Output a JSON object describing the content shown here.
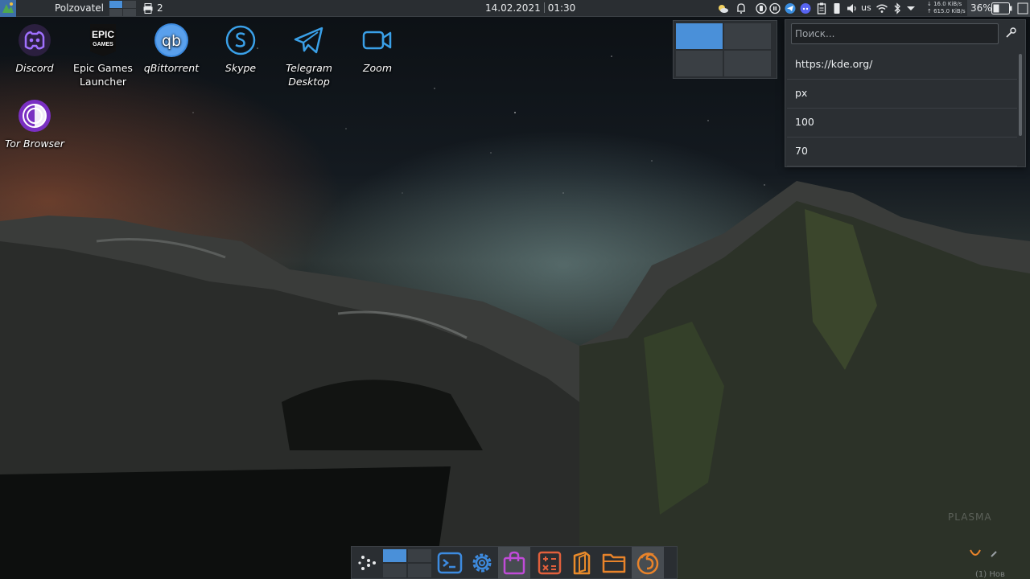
{
  "top_panel": {
    "user": "Polzovatel",
    "task_count": "2",
    "date": "14.02.2021",
    "time": "01:30",
    "keyboard_layout": "us",
    "net_down": "↓ 16.0 KiB/s",
    "net_up": "↑ 615.0 KiB/s",
    "battery": "36%"
  },
  "desktop": {
    "icons": [
      {
        "label": "Discord",
        "icon": "discord-icon",
        "color": "#8b5cf6"
      },
      {
        "label": "Epic Games Launcher",
        "icon": "epic-games-icon",
        "color": "#111111"
      },
      {
        "label": "qBittorrent",
        "icon": "qbittorrent-icon",
        "color": "#3d8be0"
      },
      {
        "label": "Skype",
        "icon": "skype-icon",
        "color": "#3aa0e8"
      },
      {
        "label": "Telegram Desktop",
        "icon": "telegram-icon",
        "color": "#3aa0e8"
      },
      {
        "label": "Zoom",
        "icon": "zoom-icon",
        "color": "#3aa0e8"
      },
      {
        "label": "Tor Browser",
        "icon": "tor-browser-icon",
        "color": "#7a2fc2"
      }
    ],
    "epic_logo_text": [
      "EPIC",
      "GAMES"
    ],
    "qb_logo_text": "qb",
    "watermark": "PLASMA",
    "corner_hint": "(1) Нов"
  },
  "clipboard": {
    "search_placeholder": "Поиск...",
    "items": [
      "https://kde.org/",
      "px",
      "100",
      "70"
    ]
  },
  "dock": {
    "items": [
      {
        "name": "app-launcher",
        "icon": "launcher-icon"
      },
      {
        "name": "pager",
        "icon": "pager-icon"
      },
      {
        "name": "terminal",
        "icon": "terminal-icon",
        "color": "#3d8be0"
      },
      {
        "name": "settings",
        "icon": "gear-icon",
        "color": "#3d8be0"
      },
      {
        "name": "software-store",
        "icon": "shopping-bag-icon",
        "color": "#c04bd8"
      },
      {
        "name": "calculator",
        "icon": "calculator-icon",
        "color": "#e2603c"
      },
      {
        "name": "office",
        "icon": "office-icon",
        "color": "#e88a2a"
      },
      {
        "name": "file-manager",
        "icon": "folder-icon",
        "color": "#e8832a"
      },
      {
        "name": "firefox",
        "icon": "firefox-icon",
        "color": "#e8832a"
      }
    ]
  },
  "colors": {
    "accent": "#4a90d9",
    "panel": "#2a2e32"
  }
}
